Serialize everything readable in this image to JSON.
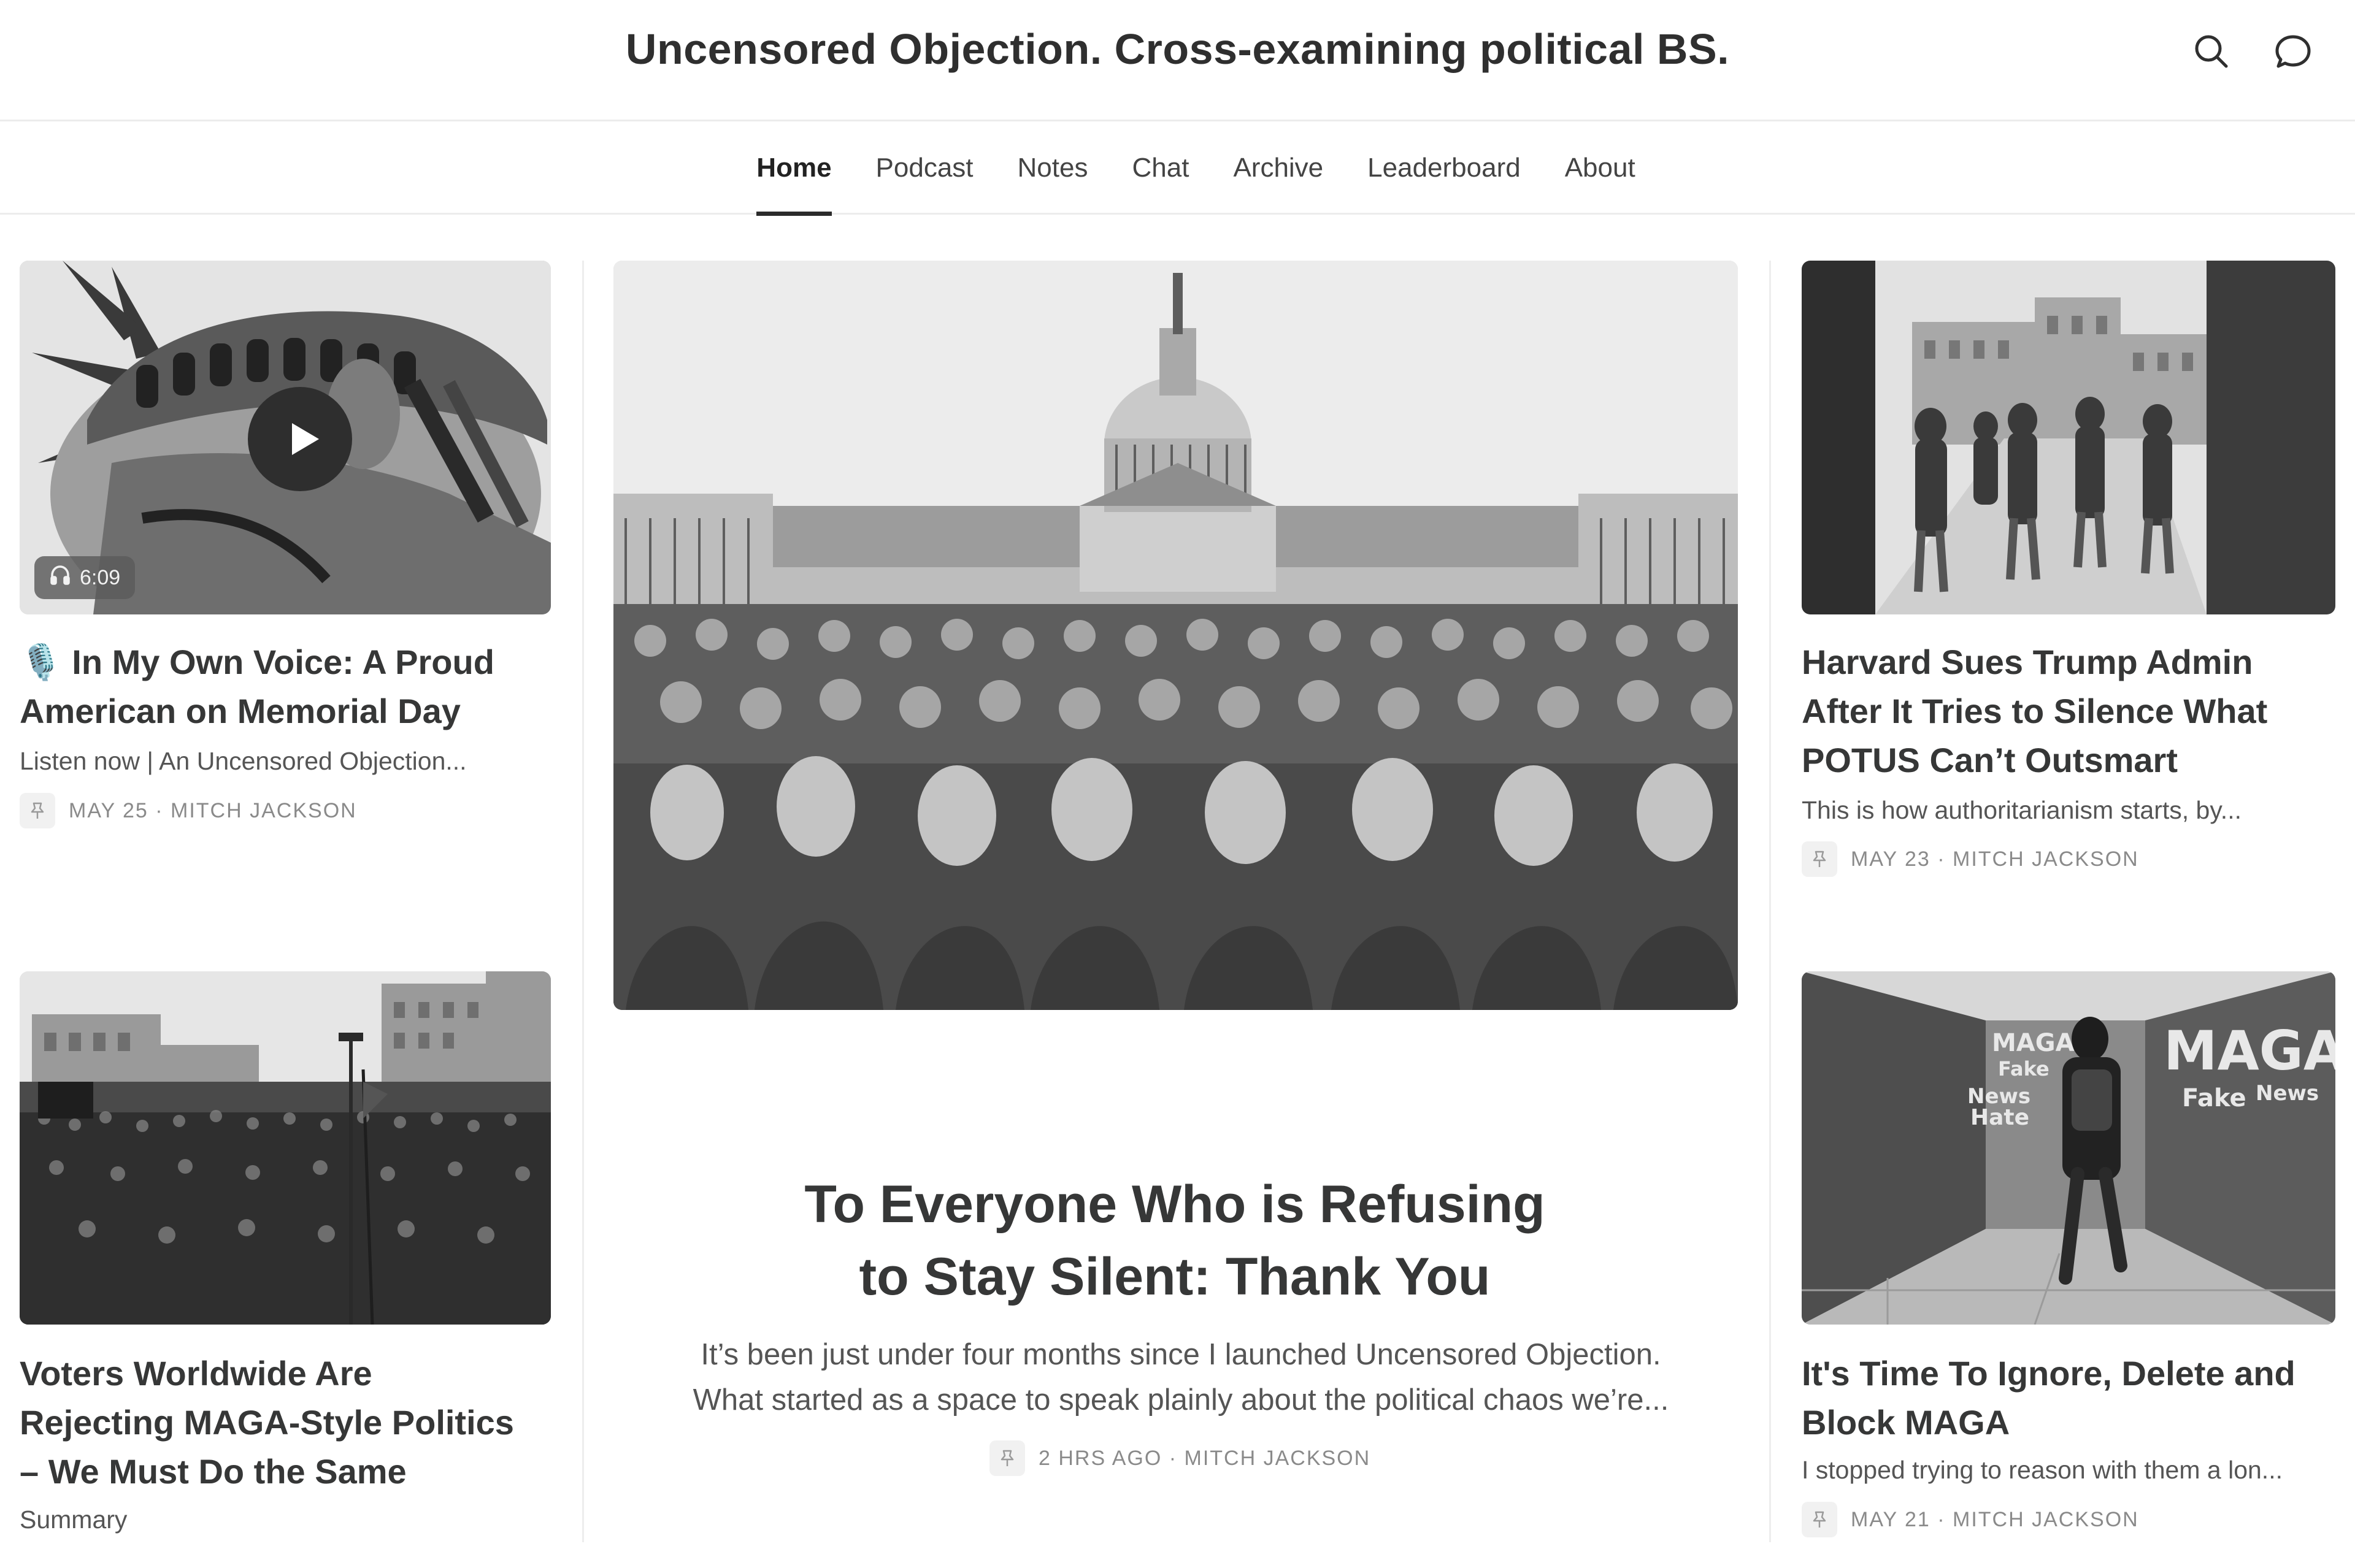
{
  "header": {
    "title": "Uncensored Objection. Cross-examining political BS.",
    "search_icon": "search-icon",
    "chat_icon": "chat-bubble-icon"
  },
  "nav": {
    "items": [
      {
        "label": "Home",
        "active": true
      },
      {
        "label": "Podcast",
        "active": false
      },
      {
        "label": "Notes",
        "active": false
      },
      {
        "label": "Chat",
        "active": false
      },
      {
        "label": "Archive",
        "active": false
      },
      {
        "label": "Leaderboard",
        "active": false
      },
      {
        "label": "About",
        "active": false
      }
    ]
  },
  "posts": {
    "left_top": {
      "title_line1": "🎙️ In My Own Voice: A Proud",
      "title_line2": "American on Memorial Day",
      "subtitle": "Listen now | An Uncensored Objection...",
      "meta": "MAY 25 · MITCH JACKSON",
      "duration": "6:09"
    },
    "left_bottom": {
      "title_line1": "Voters Worldwide Are",
      "title_line2": "Rejecting MAGA-Style Politics",
      "title_line3": "– We Must Do the Same",
      "subtitle": "Summary"
    },
    "hero": {
      "title_line1": "To Everyone Who is Refusing",
      "title_line2": "to Stay Silent: Thank You",
      "excerpt_line1": "It’s been just under four months since I launched Uncensored Objection.",
      "excerpt_line2": "What started as a space to speak plainly about the political chaos we’re...",
      "meta": "2 HRS AGO · MITCH JACKSON"
    },
    "right_top": {
      "title_line1": "Harvard Sues Trump Admin",
      "title_line2": "After It Tries to Silence What",
      "title_line3": "POTUS Can’t Outsmart",
      "subtitle": "This is how authoritarianism starts, by...",
      "meta": "MAY 23 · MITCH JACKSON"
    },
    "right_bottom": {
      "title_line1": "It's Time To Ignore, Delete and",
      "title_line2": "Block MAGA",
      "subtitle": "I stopped trying to reason with them a lon...",
      "meta": "MAY 21 · MITCH JACKSON",
      "graffiti": [
        "MAGA",
        "Fake",
        "News",
        "Hate",
        "MAGA",
        "Fake",
        "News"
      ]
    }
  }
}
